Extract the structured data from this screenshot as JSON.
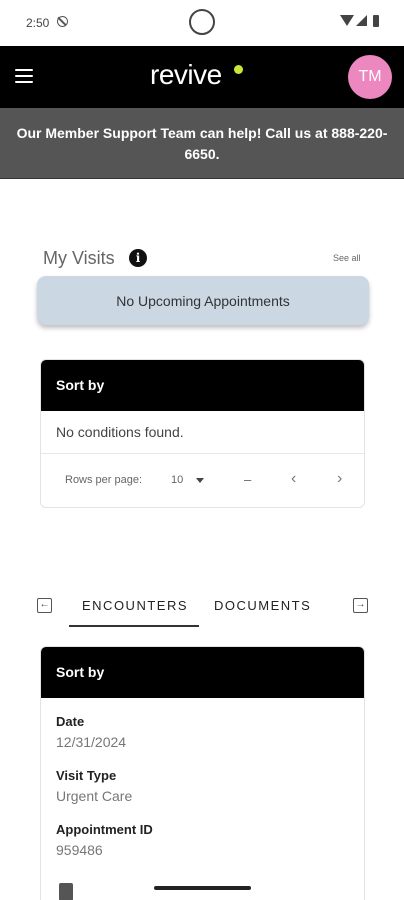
{
  "status_bar": {
    "time": "2:50"
  },
  "header": {
    "logo": "revive",
    "avatar_initials": "TM"
  },
  "banner": {
    "text": "Our Member Support Team can help! Call us at 888-220-6650."
  },
  "visits": {
    "title": "My Visits",
    "info": "i",
    "see_all": "See all",
    "empty_message": "No Upcoming Appointments"
  },
  "conditions": {
    "header": "Sort by",
    "empty_message": "No conditions found.",
    "pagination": {
      "rows_per_page_label": "Rows per page:",
      "rows_per_page_value": "10",
      "range": "–",
      "prev": "‹",
      "next": "›"
    }
  },
  "tabs": {
    "left_arrow": "←",
    "right_arrow": "→",
    "items": [
      {
        "label": "ENCOUNTERS",
        "active": true
      },
      {
        "label": "DOCUMENTS",
        "active": false
      }
    ]
  },
  "encounters": {
    "header": "Sort by",
    "fields": [
      {
        "label": "Date",
        "value": "12/31/2024"
      },
      {
        "label": "Visit Type",
        "value": "Urgent Care"
      },
      {
        "label": "Appointment ID",
        "value": "959486"
      }
    ]
  },
  "colors": {
    "header_bg": "#000000",
    "banner_bg": "#555555",
    "avatar_bg": "#ec87c0",
    "logo_accent": "#c9e63b",
    "empty_card_bg": "#ccd7e4"
  }
}
